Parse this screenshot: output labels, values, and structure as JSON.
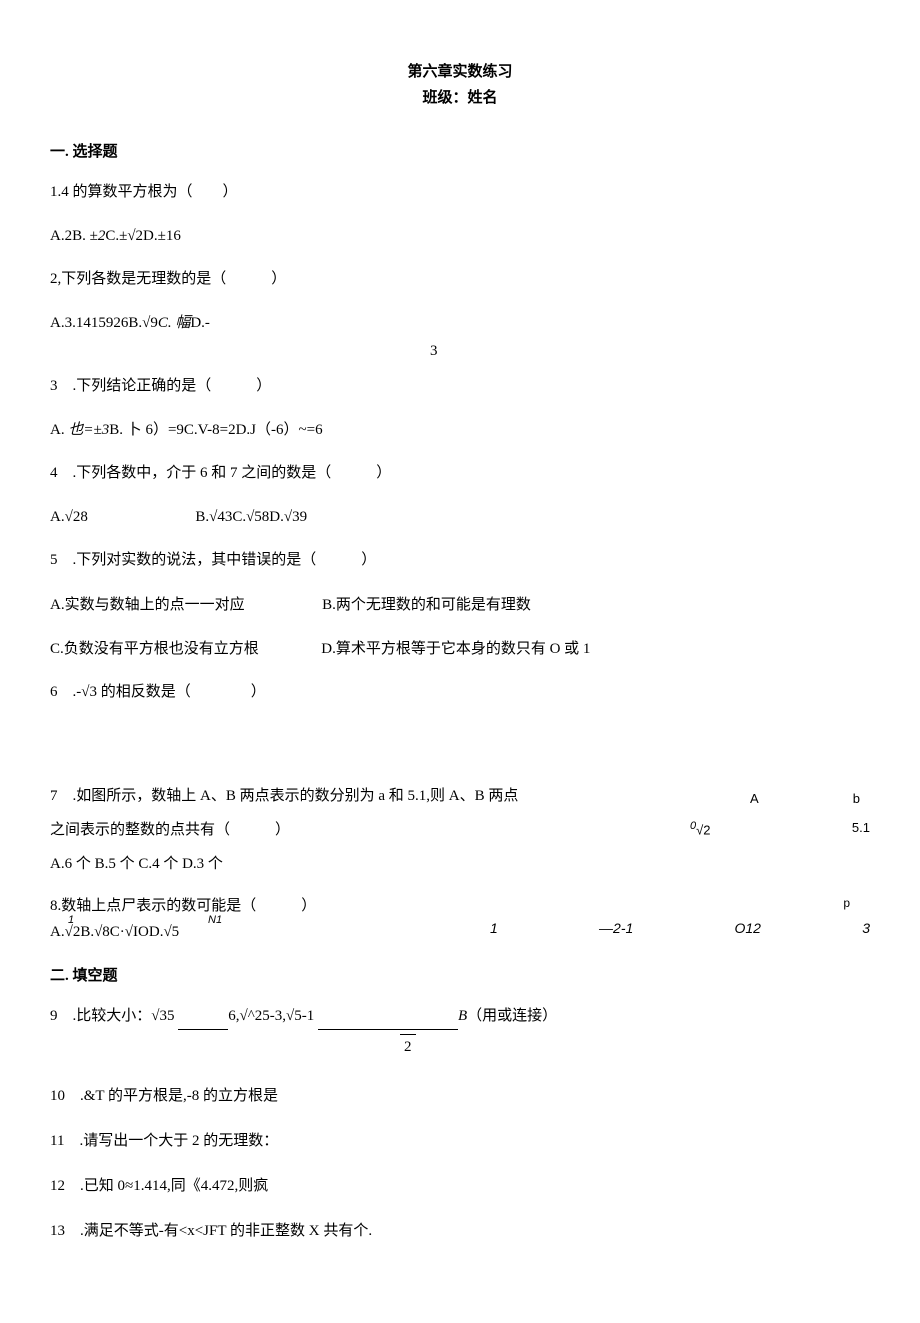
{
  "header": {
    "title": "第六章实数练习",
    "subtitle": "班级：姓名"
  },
  "section1": {
    "header": "一. 选择题",
    "q1": {
      "text": "1.4 的算数平方根为（　　）",
      "options": "A.2B. ±2C.±√2D.±16"
    },
    "q2": {
      "text": "2,下列各数是无理数的是（　　　）",
      "options_a": "A.3.1415926B.√9",
      "options_c": "C. 幅",
      "options_d": "D.-",
      "three": "3"
    },
    "q3": {
      "text": "3　.下列结论正确的是（　　　）",
      "options_a": "A.",
      "options_a2": "也=±3",
      "options_b": "B. 卜 6）=9C.V-8=2D.J（-6）~=6"
    },
    "q4": {
      "text": "4　.下列各数中，介于 6 和 7 之间的数是（　　　）",
      "opt_a": "A.√28",
      "opt_rest": "B.√43C.√58D.√39"
    },
    "q5": {
      "text": "5　.下列对实数的说法，其中错误的是（　　　）",
      "opt_a": "A.实数与数轴上的点一一对应",
      "opt_b": "B.两个无理数的和可能是有理数",
      "opt_c": "C.负数没有平方根也没有立方根",
      "opt_d": "D.算术平方根等于它本身的数只有 O 或 1"
    },
    "q6": {
      "text": "6　.-√3 的相反数是（　　　　）"
    },
    "q7": {
      "line1": "7　.如图所示，数轴上 A、B 两点表示的数分别为 a 和 5.1,则 A、B 两点",
      "line2": "之间表示的整数的点共有（　　　）",
      "options": "A.6 个 B.5 个 C.4 个 D.3 个",
      "diagram": {
        "label_a": "A",
        "label_b": "b",
        "num1_sup": "0",
        "num1": "√2",
        "num2": "5.1"
      }
    },
    "q8": {
      "text": "8.数轴上点尸表示的数可能是（　　　）",
      "sup1": "1",
      "sup2": "N1",
      "options": "A.√2B.√8C·√IOD.√5",
      "diagram": {
        "p": "p",
        "n1": "1",
        "n2": "—2-1",
        "n3": "O12",
        "n4": "3"
      }
    }
  },
  "section2": {
    "header": "二. 填空题",
    "q9": {
      "prefix": "9　.比较大小：√35 ",
      "mid1": "6,√^25-3,√5-1 ",
      "suffix_b": "B",
      "suffix": "（用或连接）",
      "frac": "2"
    },
    "q10": "10　.&T 的平方根是,-8 的立方根是",
    "q11": "11　.请写出一个大于 2 的无理数：",
    "q12": "12　.已知 0≈1.414,同《4.472,则疯",
    "q13": "13　.满足不等式-有<x<JFT 的非正整数 X 共有个."
  }
}
